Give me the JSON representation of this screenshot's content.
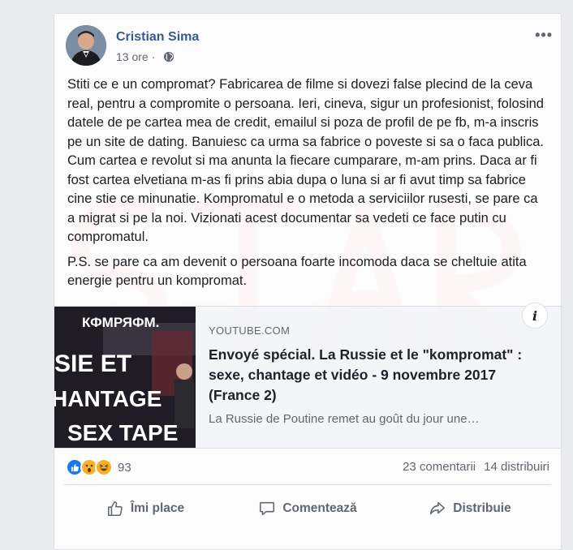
{
  "watermark": {
    "text": "STAR NEWS",
    "color": "#e2414b"
  },
  "post": {
    "author": "Cristian Sima",
    "time": "13 ore",
    "separator": "·",
    "privacy_icon": "globe-icon",
    "more_icon": "•••",
    "paragraph1": "Stiti ce e un compromat? Fabricarea de filme si dovezi false plecind de la ceva real, pentru a compromite o persoana. Ieri, cineva, sigur un profesionist, folosind datele de pe cartea mea de credit, emailul si poza de profil de pe fb, m-a inscris pe un site de dating. Banuiesc ca urma sa fabrice o poveste si sa o faca publica. Cum cartea e revolut si ma anunta la fiecare cumparare, m-am prins. Daca ar fi fost cartea elvetiana m-as fi prins abia dupa o luna si ar fi avut timp sa fabrice cine stie ce minunatie. Kompromatul e o metoda a serviciilor rusesti, se pare ca a migrat si pe la noi. Vizionati acest documentar sa vedeti ce face putin cu compromatul.",
    "paragraph2": "P.S. se pare ca am devenit o persoana foarte incomoda daca se cheltuie atita energie pentru un kompromat."
  },
  "link": {
    "thumb_lines": [
      "КФМРЯФМ.",
      "SIE ET",
      "HANTAGE",
      "SEX TAPE"
    ],
    "domain": "YOUTUBE.COM",
    "title": "Envoyé spécial. La Russie et le \"kompromat\" : sexe, chantage et vidéo - 9 novembre 2017 (France 2)",
    "description": "La Russie de Poutine remet au goût du jour une…",
    "info_label": "i"
  },
  "stats": {
    "reaction_icons": [
      "like-icon",
      "wow-icon",
      "haha-icon"
    ],
    "reaction_count": "93",
    "comments": "23 comentarii",
    "shares": "14 distribuiri"
  },
  "actions": {
    "like": "Îmi place",
    "comment": "Comentează",
    "share": "Distribuie"
  },
  "colors": {
    "link_blue": "#365899",
    "like_blue": "#1877f2",
    "reaction_yellow": "#f7b125",
    "muted": "#606770"
  }
}
